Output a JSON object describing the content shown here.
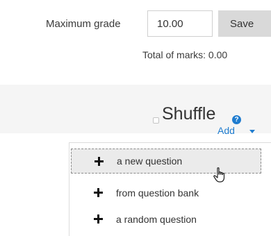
{
  "grade": {
    "label": "Maximum grade",
    "value": "10.00",
    "save_label": "Save",
    "total_marks": "Total of marks: 0.00"
  },
  "shuffle": {
    "label": "Shuffle",
    "help_glyph": "?"
  },
  "add_menu": {
    "label": "Add",
    "items": [
      {
        "label": "a new question",
        "icon": "plus-icon"
      },
      {
        "label": "from question bank",
        "icon": "plus-icon"
      },
      {
        "label": "a random question",
        "icon": "plus-icon"
      }
    ]
  },
  "colors": {
    "link": "#1f7ccf",
    "save_button": "#d9d9d9",
    "band": "#f5f5f5",
    "active_item": "#ebebeb"
  }
}
